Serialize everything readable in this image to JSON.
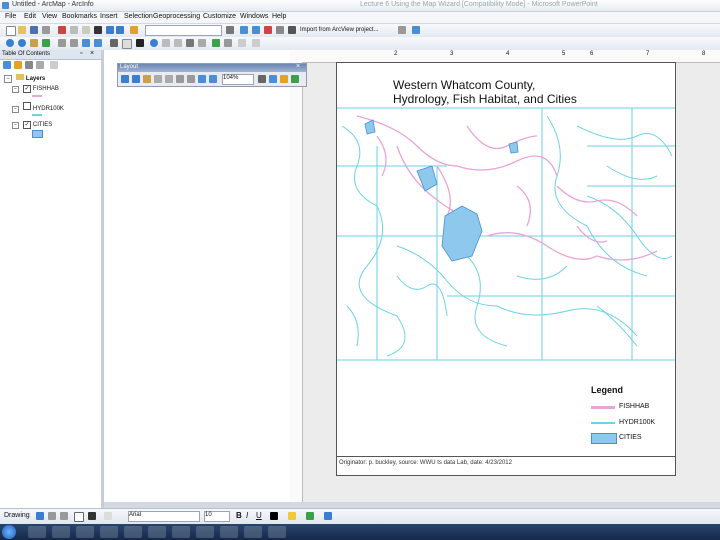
{
  "window": {
    "title": "Untitled - ArcMap - ArcInfo",
    "ppt_title": "Lecture 6 Using the Map Wizard [Compatibility Mode] - Microsoft PowerPoint"
  },
  "menu": [
    "File",
    "Edit",
    "View",
    "Bookmarks",
    "Insert",
    "Selection",
    "Geoprocessing",
    "Customize",
    "Windows",
    "Help"
  ],
  "toolbar": {
    "scale_value": "",
    "import_label": "Import from ArcView project..."
  },
  "toc": {
    "header": "Table Of Contents",
    "root": "Layers",
    "layers": [
      {
        "name": "FISHHAB",
        "checked": true,
        "color": "#e9a4d9"
      },
      {
        "name": "HYDR100K",
        "checked": false,
        "color": "#6ed2e8"
      },
      {
        "name": "CITIES",
        "checked": true,
        "color": "#8ec8ec"
      }
    ]
  },
  "layout_toolbar": {
    "title": "Layout",
    "zoom": "104%"
  },
  "ruler_labels": [
    "2",
    "3",
    "4",
    "5",
    "6",
    "7",
    "8"
  ],
  "map": {
    "title_line1": "Western Whatcom County,",
    "title_line2": "Hydrology, Fish Habitat, and Cities",
    "legend_title": "Legend",
    "legend_items": [
      {
        "label": "FISHHAB",
        "color": "#e9a4d9",
        "kind": "line"
      },
      {
        "label": "HYDR100K",
        "color": "#6ed2e8",
        "kind": "line"
      },
      {
        "label": "CITIES",
        "color": "#8ec8ec",
        "kind": "fill"
      }
    ],
    "credit": "Originator: p. buckley, source: WWU ts data Lab, date: 4/23/2012"
  },
  "drawing": {
    "label": "Drawing",
    "font": "Arial",
    "size": "10"
  }
}
